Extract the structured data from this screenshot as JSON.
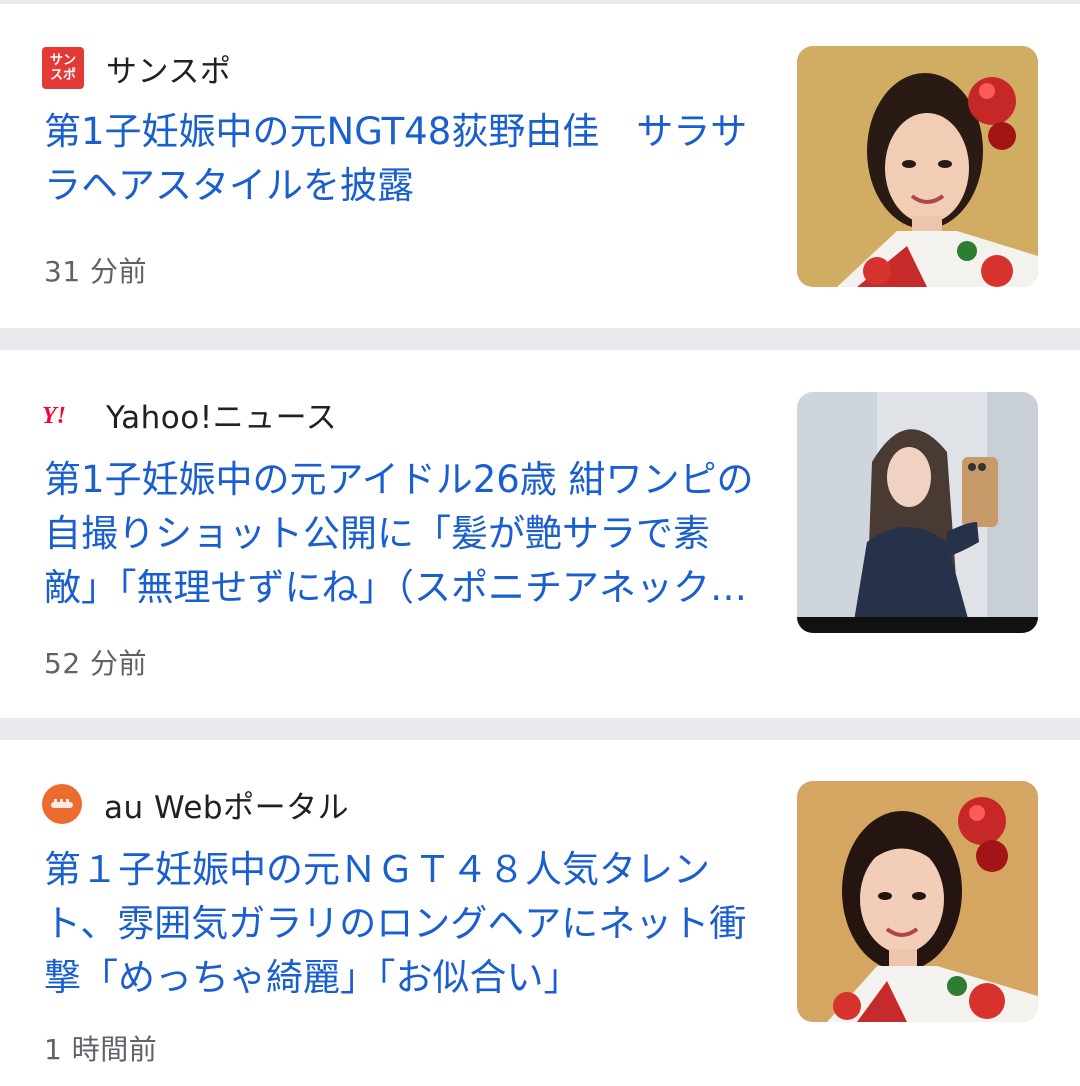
{
  "articles": [
    {
      "source": "サンスポ",
      "source_logo_lines": [
        "サン",
        "スポ"
      ],
      "title": "第1子妊娠中の元NGT48荻野由佳　サラサラヘアスタイルを披露",
      "time": "31 分前"
    },
    {
      "source": "Yahoo!ニュース",
      "source_logo": "Y!",
      "title": "第1子妊娠中の元アイドル26歳 紺ワンピの自撮りショット公開に「髪が艶サラで素敵」「無理せずにね」（スポニチアネックス）",
      "time": "52 分前"
    },
    {
      "source": "au Webポータル",
      "title": "第１子妊娠中の元ＮＧＴ４８人気タレント、雰囲気ガラリのロングヘアにネット衝撃「めっちゃ綺麗」「お似合い」",
      "time": "1 時間前"
    }
  ],
  "colors": {
    "title": "#1a5fd0",
    "separator": "#e8eaed",
    "sansupo_logo": "#e53935",
    "yahoo_logo": "#ff0033",
    "au_logo": "#eb6c2e"
  }
}
